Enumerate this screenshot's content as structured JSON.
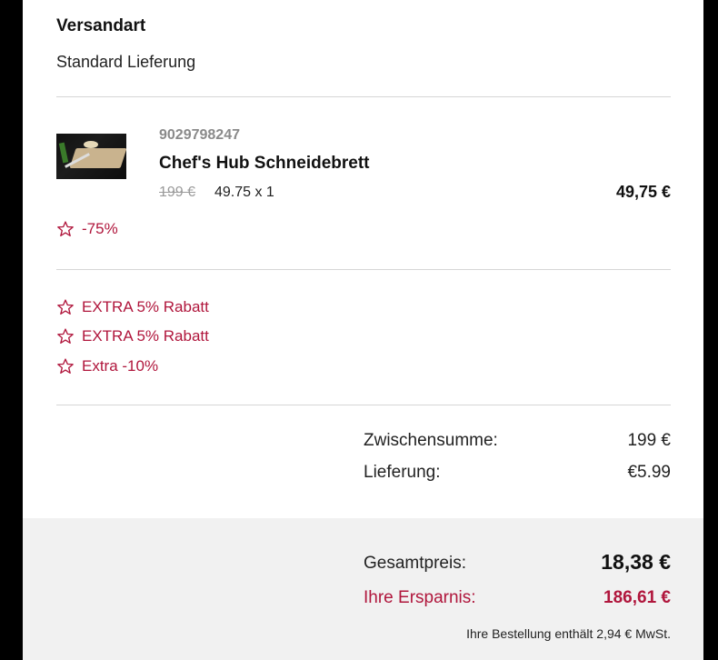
{
  "shipping": {
    "title": "Versandart",
    "method": "Standard Lieferung"
  },
  "product": {
    "sku": "9029798247",
    "name": "Chef's Hub Schneidebrett",
    "old_price": "199 €",
    "unit_price_qty": "49.75 x 1",
    "line_total": "49,75 €",
    "discount_badge": "-75%",
    "image_icon": "cutting-board-product-image"
  },
  "promotions": [
    {
      "label": "EXTRA 5% Rabatt"
    },
    {
      "label": "EXTRA 5% Rabatt"
    },
    {
      "label": "Extra -10%"
    }
  ],
  "summary": {
    "subtotal_label": "Zwischensumme:",
    "subtotal_value": "199 €",
    "delivery_label": "Lieferung:",
    "delivery_value": "€5.99"
  },
  "totals": {
    "total_label": "Gesamtpreis:",
    "total_value": "18,38 €",
    "savings_label": "Ihre Ersparnis:",
    "savings_value": "186,61 €",
    "vat_note": "Ihre Bestellung enthält 2,94 € MwSt."
  },
  "colors": {
    "accent": "#b0163c",
    "muted": "#8a8a8a",
    "background": "#000000",
    "panel": "#ffffff",
    "totals_background": "#f1f1f1"
  }
}
